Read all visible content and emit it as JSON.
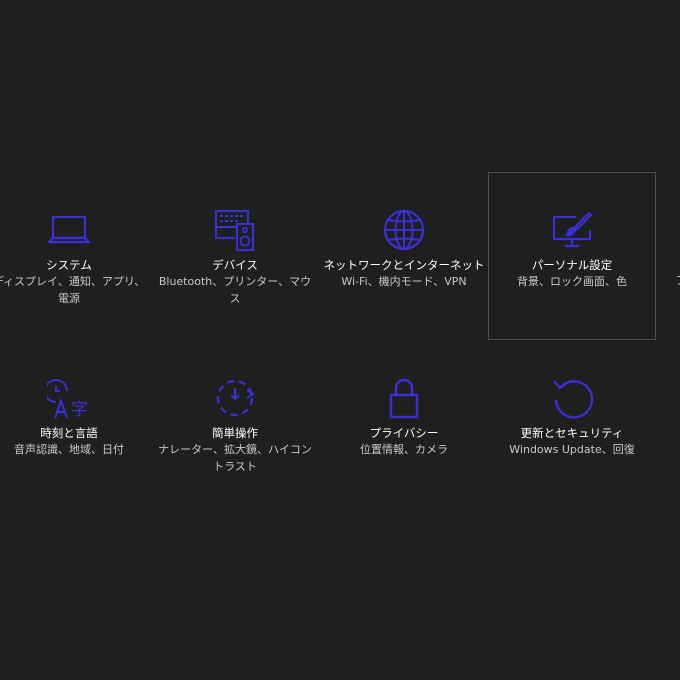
{
  "accent_color": "#3b2fd6",
  "background_color": "#1f1f1f",
  "tiles": [
    {
      "label": "システム",
      "desc": "ディスプレイ、通知、アプリ、電源",
      "icon": "laptop-icon"
    },
    {
      "label": "デバイス",
      "desc": "Bluetooth、プリンター、マウス",
      "icon": "keyboard-speaker-icon"
    },
    {
      "label": "ネットワークとインターネット",
      "desc": "Wi-Fi、機内モード、VPN",
      "icon": "globe-icon"
    },
    {
      "label": "パーソナル設定",
      "desc": "背景、ロック画面、色",
      "icon": "paintbrush-monitor-icon",
      "selected": true
    },
    {
      "label": "時刻と言語",
      "desc": "音声認識、地域、日付",
      "icon": "clock-language-icon"
    },
    {
      "label": "簡単操作",
      "desc": "ナレーター、拡大鏡、ハイコントラスト",
      "icon": "ease-of-access-timer-icon"
    },
    {
      "label": "プライバシー",
      "desc": "位置情報、カメラ",
      "icon": "lock-icon"
    },
    {
      "label": "更新とセキュリティ",
      "desc": "Windows Update、回復",
      "icon": "refresh-icon"
    }
  ],
  "clipped_text": "ア"
}
